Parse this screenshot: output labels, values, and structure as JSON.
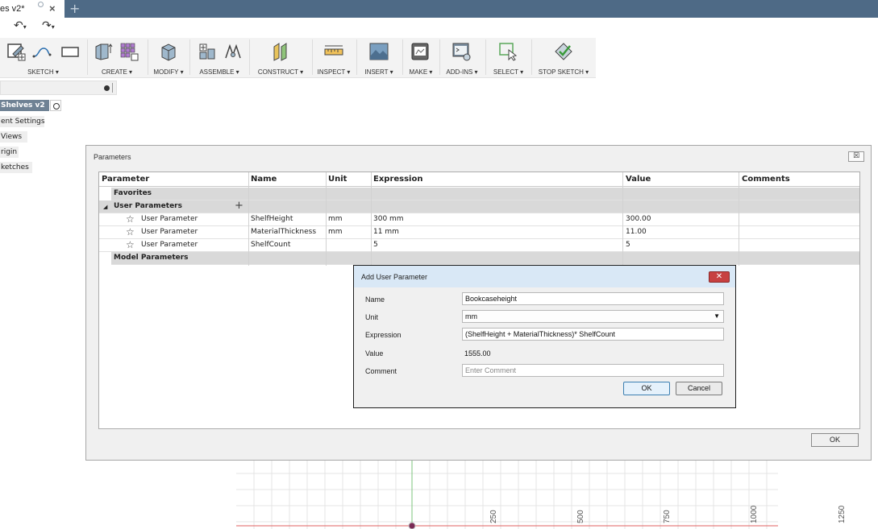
{
  "tabbar": {
    "doc_title": "es v2*",
    "close_glyph": "×",
    "new_tab_glyph": "+"
  },
  "quick_access": {
    "undo_glyph": "↶",
    "redo_glyph": "↷",
    "dropdown_glyph": "▾"
  },
  "toolbar": {
    "groups": [
      {
        "label": "SKETCH ▾"
      },
      {
        "label": "CREATE ▾"
      },
      {
        "label": "MODIFY ▾"
      },
      {
        "label": "ASSEMBLE ▾"
      },
      {
        "label": "CONSTRUCT ▾"
      },
      {
        "label": "INSPECT ▾"
      },
      {
        "label": "INSERT ▾"
      },
      {
        "label": "MAKE ▾"
      },
      {
        "label": "ADD-INS ▾"
      },
      {
        "label": "SELECT ▾"
      },
      {
        "label": "STOP SKETCH ▾"
      }
    ]
  },
  "browser": {
    "root": "Shelves v2",
    "nodes": [
      "ent Settings",
      "Views",
      "rigin",
      "ketches"
    ]
  },
  "parameters": {
    "title": "Parameters",
    "close_glyph": "☒",
    "columns": {
      "parameter": "Parameter",
      "name": "Name",
      "unit": "Unit",
      "expression": "Expression",
      "value": "Value",
      "comments": "Comments"
    },
    "favorites_label": "Favorites",
    "user_params_label": "User Parameters",
    "expand_glyph": "◢",
    "add_glyph": "+",
    "star_glyph": "☆",
    "model_params_label": "Model Parameters",
    "rows": [
      {
        "type": "User Parameter",
        "name": "ShelfHeight",
        "unit": "mm",
        "expression": "300 mm",
        "value": "300.00"
      },
      {
        "type": "User Parameter",
        "name": "MaterialThickness",
        "unit": "mm",
        "expression": "11 mm",
        "value": "11.00"
      },
      {
        "type": "User Parameter",
        "name": "ShelfCount",
        "unit": "",
        "expression": "5",
        "value": "5"
      }
    ],
    "ok_label": "OK"
  },
  "add_user_parameter": {
    "title": "Add User Parameter",
    "close_glyph": "✕",
    "name_label": "Name",
    "name_value": "Bookcaseheight",
    "unit_label": "Unit",
    "unit_value": "mm",
    "unit_arrow": "▼",
    "expression_label": "Expression",
    "expression_value": "(ShelfHeight + MaterialThickness)* ShelfCount",
    "value_label": "Value",
    "value_value": "1555.00",
    "comment_label": "Comment",
    "comment_placeholder": "Enter Comment",
    "ok_label": "OK",
    "cancel_label": "Cancel"
  },
  "canvas": {
    "ruler_labels": [
      "250",
      "500",
      "750",
      "1000",
      "1250"
    ]
  },
  "colors": {
    "tabbar": "#4e6a86",
    "browser_root": "#6f8294",
    "section_row": "#d9d9d9",
    "dialog_title": "#d9e8f6",
    "close_button": "#c74040",
    "axis_green": "#7cc47c",
    "axis_red": "#e06060",
    "origin": "#7a2a55"
  }
}
